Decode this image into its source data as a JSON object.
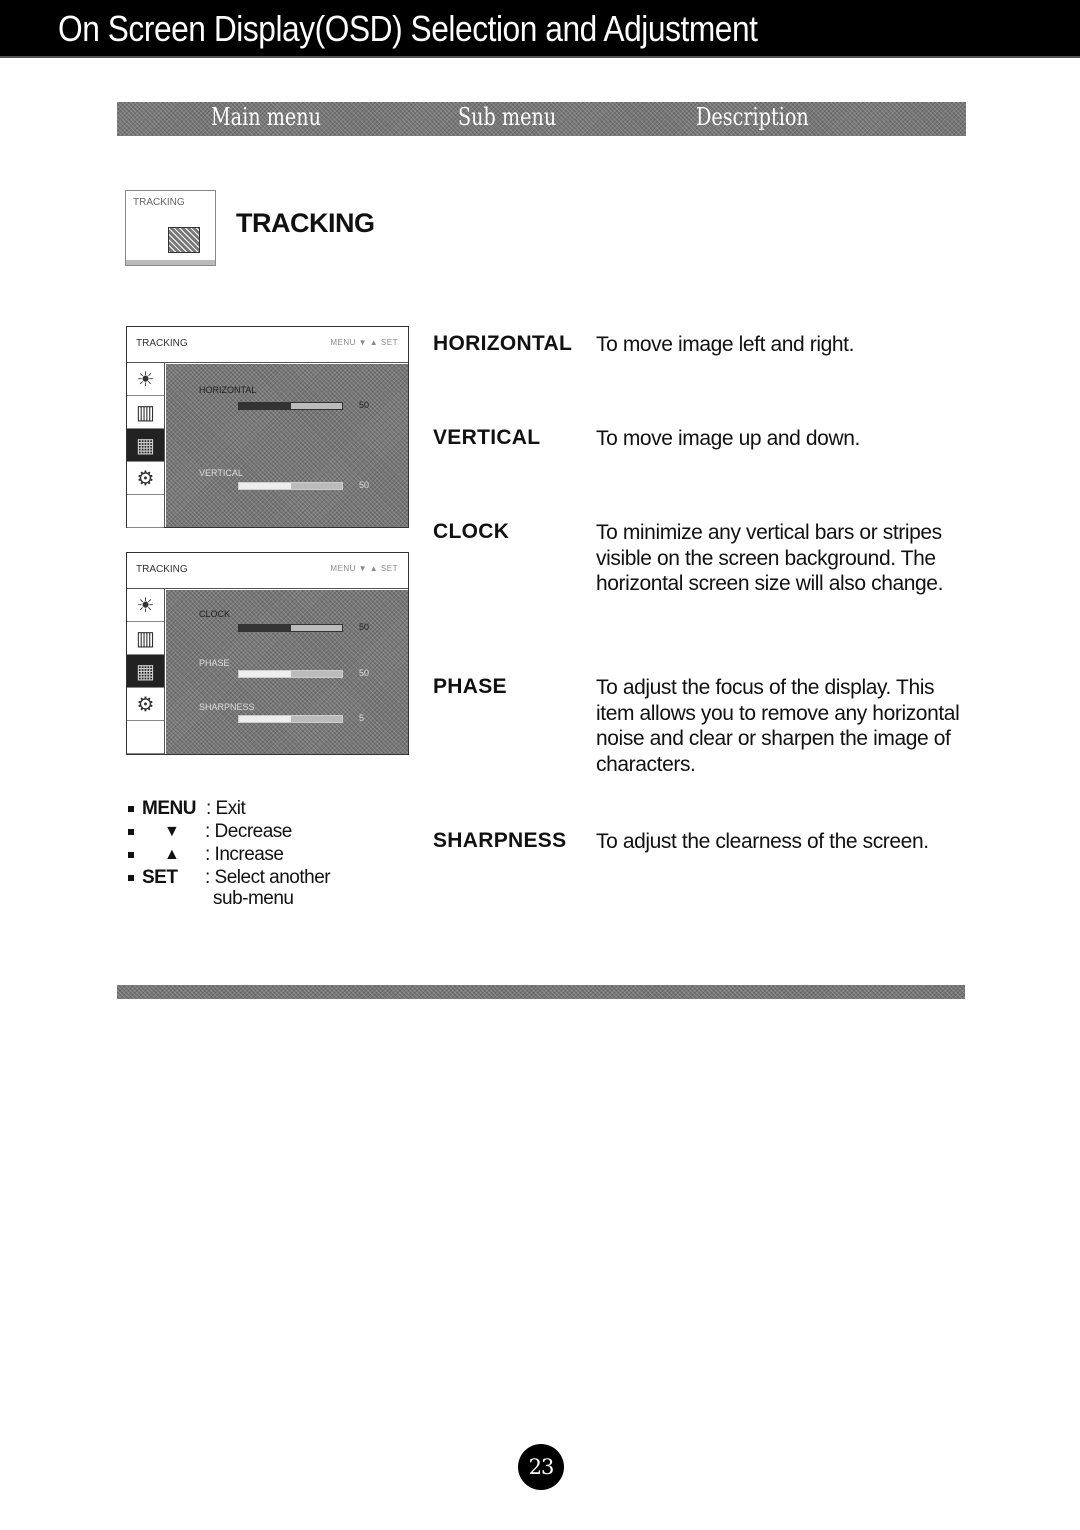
{
  "header": {
    "title": "On Screen Display(OSD) Selection and Adjustment"
  },
  "columns": {
    "main_menu": "Main menu",
    "sub_menu": "Sub menu",
    "description": "Description"
  },
  "main_menu": {
    "icon_label": "TRACKING",
    "title": "TRACKING"
  },
  "osd_screens": [
    {
      "title": "TRACKING",
      "keys": "MENU ▼ ▲ SET",
      "side_icons": [
        "brightness-icon",
        "color-icon",
        "tracking-icon",
        "setup-icon",
        "blank"
      ],
      "active_tab": 2,
      "items": [
        {
          "label": "HORIZONTAL",
          "value": "50",
          "fill": 0.5,
          "selected": true
        },
        {
          "label": "VERTICAL",
          "value": "50",
          "fill": 0.5,
          "selected": false
        }
      ]
    },
    {
      "title": "TRACKING",
      "keys": "MENU ▼ ▲ SET",
      "side_icons": [
        "brightness-icon",
        "color-icon",
        "tracking-icon",
        "setup-icon",
        "blank"
      ],
      "active_tab": 2,
      "items": [
        {
          "label": "CLOCK",
          "value": "50",
          "fill": 0.5,
          "selected": true
        },
        {
          "label": "PHASE",
          "value": "50",
          "fill": 0.5,
          "selected": false
        },
        {
          "label": "SHARPNESS",
          "value": "5",
          "fill": 0.5,
          "selected": false
        }
      ]
    }
  ],
  "legend": [
    {
      "key": "MENU",
      "desc": ": Exit"
    },
    {
      "key": "▼",
      "desc": ": Decrease"
    },
    {
      "key": "▲",
      "desc": ": Increase"
    },
    {
      "key": "SET",
      "desc": ": Select another",
      "desc2": "sub-menu"
    }
  ],
  "entries": [
    {
      "name": "HORIZONTAL",
      "desc": "To move image left and right."
    },
    {
      "name": "VERTICAL",
      "desc": "To move image up and down."
    },
    {
      "name": "CLOCK",
      "desc": "To minimize any vertical bars or stripes visible on the screen background. The horizontal screen size will also change."
    },
    {
      "name": "PHASE",
      "desc": "To adjust the focus of the display. This item allows you to remove any horizontal noise and clear or sharpen the image of characters."
    },
    {
      "name": "SHARPNESS",
      "desc": "To adjust the clearness of the screen."
    }
  ],
  "footer": {
    "page_number": "23"
  }
}
